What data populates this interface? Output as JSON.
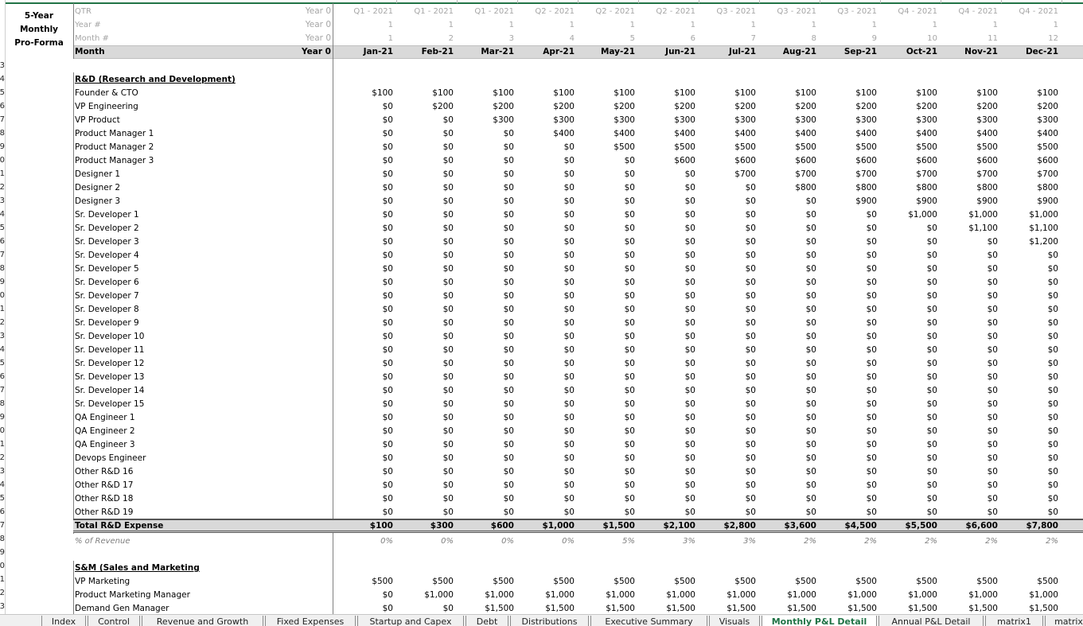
{
  "title": {
    "line1": "5-Year Monthly",
    "line2": "Pro-Forma"
  },
  "header_rows": {
    "qtr_label": "QTR",
    "year_label": "Year #",
    "month_num_label": "Month #",
    "month_label": "Month",
    "year0_qtr": "Year 0",
    "year0_year": "Year 0",
    "year0_month": "Year 0",
    "year0_month_bold": "Year 0",
    "col0_year": "1",
    "col0_month": "1"
  },
  "months": [
    {
      "qtr": "Q1 - 2021",
      "year": "1",
      "num": "1",
      "month": "Jan-21"
    },
    {
      "qtr": "Q1 - 2021",
      "year": "1",
      "num": "2",
      "month": "Feb-21"
    },
    {
      "qtr": "Q1 - 2021",
      "year": "1",
      "num": "3",
      "month": "Mar-21"
    },
    {
      "qtr": "Q2 - 2021",
      "year": "1",
      "num": "4",
      "month": "Apr-21"
    },
    {
      "qtr": "Q2 - 2021",
      "year": "1",
      "num": "5",
      "month": "May-21"
    },
    {
      "qtr": "Q2 - 2021",
      "year": "1",
      "num": "6",
      "month": "Jun-21"
    },
    {
      "qtr": "Q3 - 2021",
      "year": "1",
      "num": "7",
      "month": "Jul-21"
    },
    {
      "qtr": "Q3 - 2021",
      "year": "1",
      "num": "8",
      "month": "Aug-21"
    },
    {
      "qtr": "Q3 - 2021",
      "year": "1",
      "num": "9",
      "month": "Sep-21"
    },
    {
      "qtr": "Q4 - 2021",
      "year": "1",
      "num": "10",
      "month": "Oct-21"
    },
    {
      "qtr": "Q4 - 2021",
      "year": "1",
      "num": "11",
      "month": "Nov-21"
    },
    {
      "qtr": "Q4 - 2021",
      "year": "1",
      "num": "12",
      "month": "Dec-21"
    }
  ],
  "row_numbers": [
    "3",
    "4",
    "5",
    "6",
    "7",
    "8",
    "9",
    "0",
    "1",
    "2",
    "3",
    "4",
    "5",
    "6",
    "7",
    "8",
    "9",
    "0",
    "1",
    "2",
    "3",
    "4",
    "5",
    "6",
    "7",
    "8",
    "9",
    "0",
    "1",
    "2",
    "3",
    "4",
    "5",
    "6",
    "7",
    "8",
    "9",
    "0",
    "1",
    "2",
    "3"
  ],
  "rd": {
    "heading": "R&D (Research and Development)",
    "rows": [
      {
        "label": "Founder & CTO",
        "values": [
          "$100",
          "$100",
          "$100",
          "$100",
          "$100",
          "$100",
          "$100",
          "$100",
          "$100",
          "$100",
          "$100",
          "$100"
        ]
      },
      {
        "label": "VP Engineering",
        "values": [
          "$0",
          "$200",
          "$200",
          "$200",
          "$200",
          "$200",
          "$200",
          "$200",
          "$200",
          "$200",
          "$200",
          "$200"
        ]
      },
      {
        "label": "VP Product",
        "values": [
          "$0",
          "$0",
          "$300",
          "$300",
          "$300",
          "$300",
          "$300",
          "$300",
          "$300",
          "$300",
          "$300",
          "$300"
        ]
      },
      {
        "label": "Product Manager 1",
        "values": [
          "$0",
          "$0",
          "$0",
          "$400",
          "$400",
          "$400",
          "$400",
          "$400",
          "$400",
          "$400",
          "$400",
          "$400"
        ]
      },
      {
        "label": "Product Manager 2",
        "values": [
          "$0",
          "$0",
          "$0",
          "$0",
          "$500",
          "$500",
          "$500",
          "$500",
          "$500",
          "$500",
          "$500",
          "$500"
        ]
      },
      {
        "label": "Product Manager 3",
        "values": [
          "$0",
          "$0",
          "$0",
          "$0",
          "$0",
          "$600",
          "$600",
          "$600",
          "$600",
          "$600",
          "$600",
          "$600"
        ]
      },
      {
        "label": "Designer 1",
        "values": [
          "$0",
          "$0",
          "$0",
          "$0",
          "$0",
          "$0",
          "$700",
          "$700",
          "$700",
          "$700",
          "$700",
          "$700"
        ]
      },
      {
        "label": "Designer 2",
        "values": [
          "$0",
          "$0",
          "$0",
          "$0",
          "$0",
          "$0",
          "$0",
          "$800",
          "$800",
          "$800",
          "$800",
          "$800"
        ]
      },
      {
        "label": "Designer 3",
        "values": [
          "$0",
          "$0",
          "$0",
          "$0",
          "$0",
          "$0",
          "$0",
          "$0",
          "$900",
          "$900",
          "$900",
          "$900"
        ]
      },
      {
        "label": "Sr. Developer 1",
        "values": [
          "$0",
          "$0",
          "$0",
          "$0",
          "$0",
          "$0",
          "$0",
          "$0",
          "$0",
          "$1,000",
          "$1,000",
          "$1,000"
        ]
      },
      {
        "label": "Sr. Developer 2",
        "values": [
          "$0",
          "$0",
          "$0",
          "$0",
          "$0",
          "$0",
          "$0",
          "$0",
          "$0",
          "$0",
          "$1,100",
          "$1,100"
        ]
      },
      {
        "label": "Sr. Developer 3",
        "values": [
          "$0",
          "$0",
          "$0",
          "$0",
          "$0",
          "$0",
          "$0",
          "$0",
          "$0",
          "$0",
          "$0",
          "$1,200"
        ]
      },
      {
        "label": "Sr. Developer 4",
        "values": [
          "$0",
          "$0",
          "$0",
          "$0",
          "$0",
          "$0",
          "$0",
          "$0",
          "$0",
          "$0",
          "$0",
          "$0"
        ]
      },
      {
        "label": "Sr. Developer 5",
        "values": [
          "$0",
          "$0",
          "$0",
          "$0",
          "$0",
          "$0",
          "$0",
          "$0",
          "$0",
          "$0",
          "$0",
          "$0"
        ]
      },
      {
        "label": "Sr. Developer 6",
        "values": [
          "$0",
          "$0",
          "$0",
          "$0",
          "$0",
          "$0",
          "$0",
          "$0",
          "$0",
          "$0",
          "$0",
          "$0"
        ]
      },
      {
        "label": "Sr. Developer 7",
        "values": [
          "$0",
          "$0",
          "$0",
          "$0",
          "$0",
          "$0",
          "$0",
          "$0",
          "$0",
          "$0",
          "$0",
          "$0"
        ]
      },
      {
        "label": "Sr. Developer 8",
        "values": [
          "$0",
          "$0",
          "$0",
          "$0",
          "$0",
          "$0",
          "$0",
          "$0",
          "$0",
          "$0",
          "$0",
          "$0"
        ]
      },
      {
        "label": "Sr. Developer 9",
        "values": [
          "$0",
          "$0",
          "$0",
          "$0",
          "$0",
          "$0",
          "$0",
          "$0",
          "$0",
          "$0",
          "$0",
          "$0"
        ]
      },
      {
        "label": "Sr. Developer 10",
        "values": [
          "$0",
          "$0",
          "$0",
          "$0",
          "$0",
          "$0",
          "$0",
          "$0",
          "$0",
          "$0",
          "$0",
          "$0"
        ]
      },
      {
        "label": "Sr. Developer 11",
        "values": [
          "$0",
          "$0",
          "$0",
          "$0",
          "$0",
          "$0",
          "$0",
          "$0",
          "$0",
          "$0",
          "$0",
          "$0"
        ]
      },
      {
        "label": "Sr. Developer 12",
        "values": [
          "$0",
          "$0",
          "$0",
          "$0",
          "$0",
          "$0",
          "$0",
          "$0",
          "$0",
          "$0",
          "$0",
          "$0"
        ]
      },
      {
        "label": "Sr. Developer 13",
        "values": [
          "$0",
          "$0",
          "$0",
          "$0",
          "$0",
          "$0",
          "$0",
          "$0",
          "$0",
          "$0",
          "$0",
          "$0"
        ]
      },
      {
        "label": "Sr. Developer 14",
        "values": [
          "$0",
          "$0",
          "$0",
          "$0",
          "$0",
          "$0",
          "$0",
          "$0",
          "$0",
          "$0",
          "$0",
          "$0"
        ]
      },
      {
        "label": "Sr. Developer 15",
        "values": [
          "$0",
          "$0",
          "$0",
          "$0",
          "$0",
          "$0",
          "$0",
          "$0",
          "$0",
          "$0",
          "$0",
          "$0"
        ]
      },
      {
        "label": "QA Engineer 1",
        "values": [
          "$0",
          "$0",
          "$0",
          "$0",
          "$0",
          "$0",
          "$0",
          "$0",
          "$0",
          "$0",
          "$0",
          "$0"
        ]
      },
      {
        "label": "QA Engineer 2",
        "values": [
          "$0",
          "$0",
          "$0",
          "$0",
          "$0",
          "$0",
          "$0",
          "$0",
          "$0",
          "$0",
          "$0",
          "$0"
        ]
      },
      {
        "label": "QA Engineer 3",
        "values": [
          "$0",
          "$0",
          "$0",
          "$0",
          "$0",
          "$0",
          "$0",
          "$0",
          "$0",
          "$0",
          "$0",
          "$0"
        ]
      },
      {
        "label": "Devops Engineer",
        "values": [
          "$0",
          "$0",
          "$0",
          "$0",
          "$0",
          "$0",
          "$0",
          "$0",
          "$0",
          "$0",
          "$0",
          "$0"
        ]
      },
      {
        "label": "Other R&D 16",
        "values": [
          "$0",
          "$0",
          "$0",
          "$0",
          "$0",
          "$0",
          "$0",
          "$0",
          "$0",
          "$0",
          "$0",
          "$0"
        ]
      },
      {
        "label": "Other R&D 17",
        "values": [
          "$0",
          "$0",
          "$0",
          "$0",
          "$0",
          "$0",
          "$0",
          "$0",
          "$0",
          "$0",
          "$0",
          "$0"
        ]
      },
      {
        "label": "Other R&D 18",
        "values": [
          "$0",
          "$0",
          "$0",
          "$0",
          "$0",
          "$0",
          "$0",
          "$0",
          "$0",
          "$0",
          "$0",
          "$0"
        ]
      },
      {
        "label": "Other R&D 19",
        "values": [
          "$0",
          "$0",
          "$0",
          "$0",
          "$0",
          "$0",
          "$0",
          "$0",
          "$0",
          "$0",
          "$0",
          "$0"
        ]
      }
    ],
    "total": {
      "label": "Total R&D Expense",
      "values": [
        "$100",
        "$300",
        "$600",
        "$1,000",
        "$1,500",
        "$2,100",
        "$2,800",
        "$3,600",
        "$4,500",
        "$5,500",
        "$6,600",
        "$7,800"
      ]
    },
    "pct": {
      "label": "% of Revenue",
      "values": [
        "0%",
        "0%",
        "0%",
        "0%",
        "5%",
        "3%",
        "3%",
        "2%",
        "2%",
        "2%",
        "2%",
        "2%"
      ]
    }
  },
  "sm": {
    "heading": "S&M (Sales and Marketing",
    "rows": [
      {
        "label": "VP Marketing",
        "values": [
          "$500",
          "$500",
          "$500",
          "$500",
          "$500",
          "$500",
          "$500",
          "$500",
          "$500",
          "$500",
          "$500",
          "$500"
        ]
      },
      {
        "label": "Product Marketing Manager",
        "values": [
          "$0",
          "$1,000",
          "$1,000",
          "$1,000",
          "$1,000",
          "$1,000",
          "$1,000",
          "$1,000",
          "$1,000",
          "$1,000",
          "$1,000",
          "$1,000"
        ]
      },
      {
        "label": "Demand Gen Manager",
        "values": [
          "$0",
          "$0",
          "$1,500",
          "$1,500",
          "$1,500",
          "$1,500",
          "$1,500",
          "$1,500",
          "$1,500",
          "$1,500",
          "$1,500",
          "$1,500"
        ]
      }
    ]
  },
  "tabs": [
    {
      "label": "Index",
      "active": false
    },
    {
      "label": "Control",
      "active": false
    },
    {
      "label": "Revenue and Growth",
      "active": false
    },
    {
      "label": "Fixed Expenses",
      "active": false
    },
    {
      "label": "Startup and Capex",
      "active": false
    },
    {
      "label": "Debt",
      "active": false
    },
    {
      "label": "Distributions",
      "active": false
    },
    {
      "label": "Executive Summary",
      "active": false
    },
    {
      "label": "Visuals",
      "active": false
    },
    {
      "label": "Monthly P&L Detail",
      "active": true
    },
    {
      "label": "Annual P&L Detail",
      "active": false
    },
    {
      "label": "matrix1",
      "active": false
    },
    {
      "label": "matrix",
      "active": false
    }
  ],
  "colors": {
    "accent": "#217346",
    "header_fill": "#d9d9d9",
    "muted": "#a6a6a6"
  }
}
